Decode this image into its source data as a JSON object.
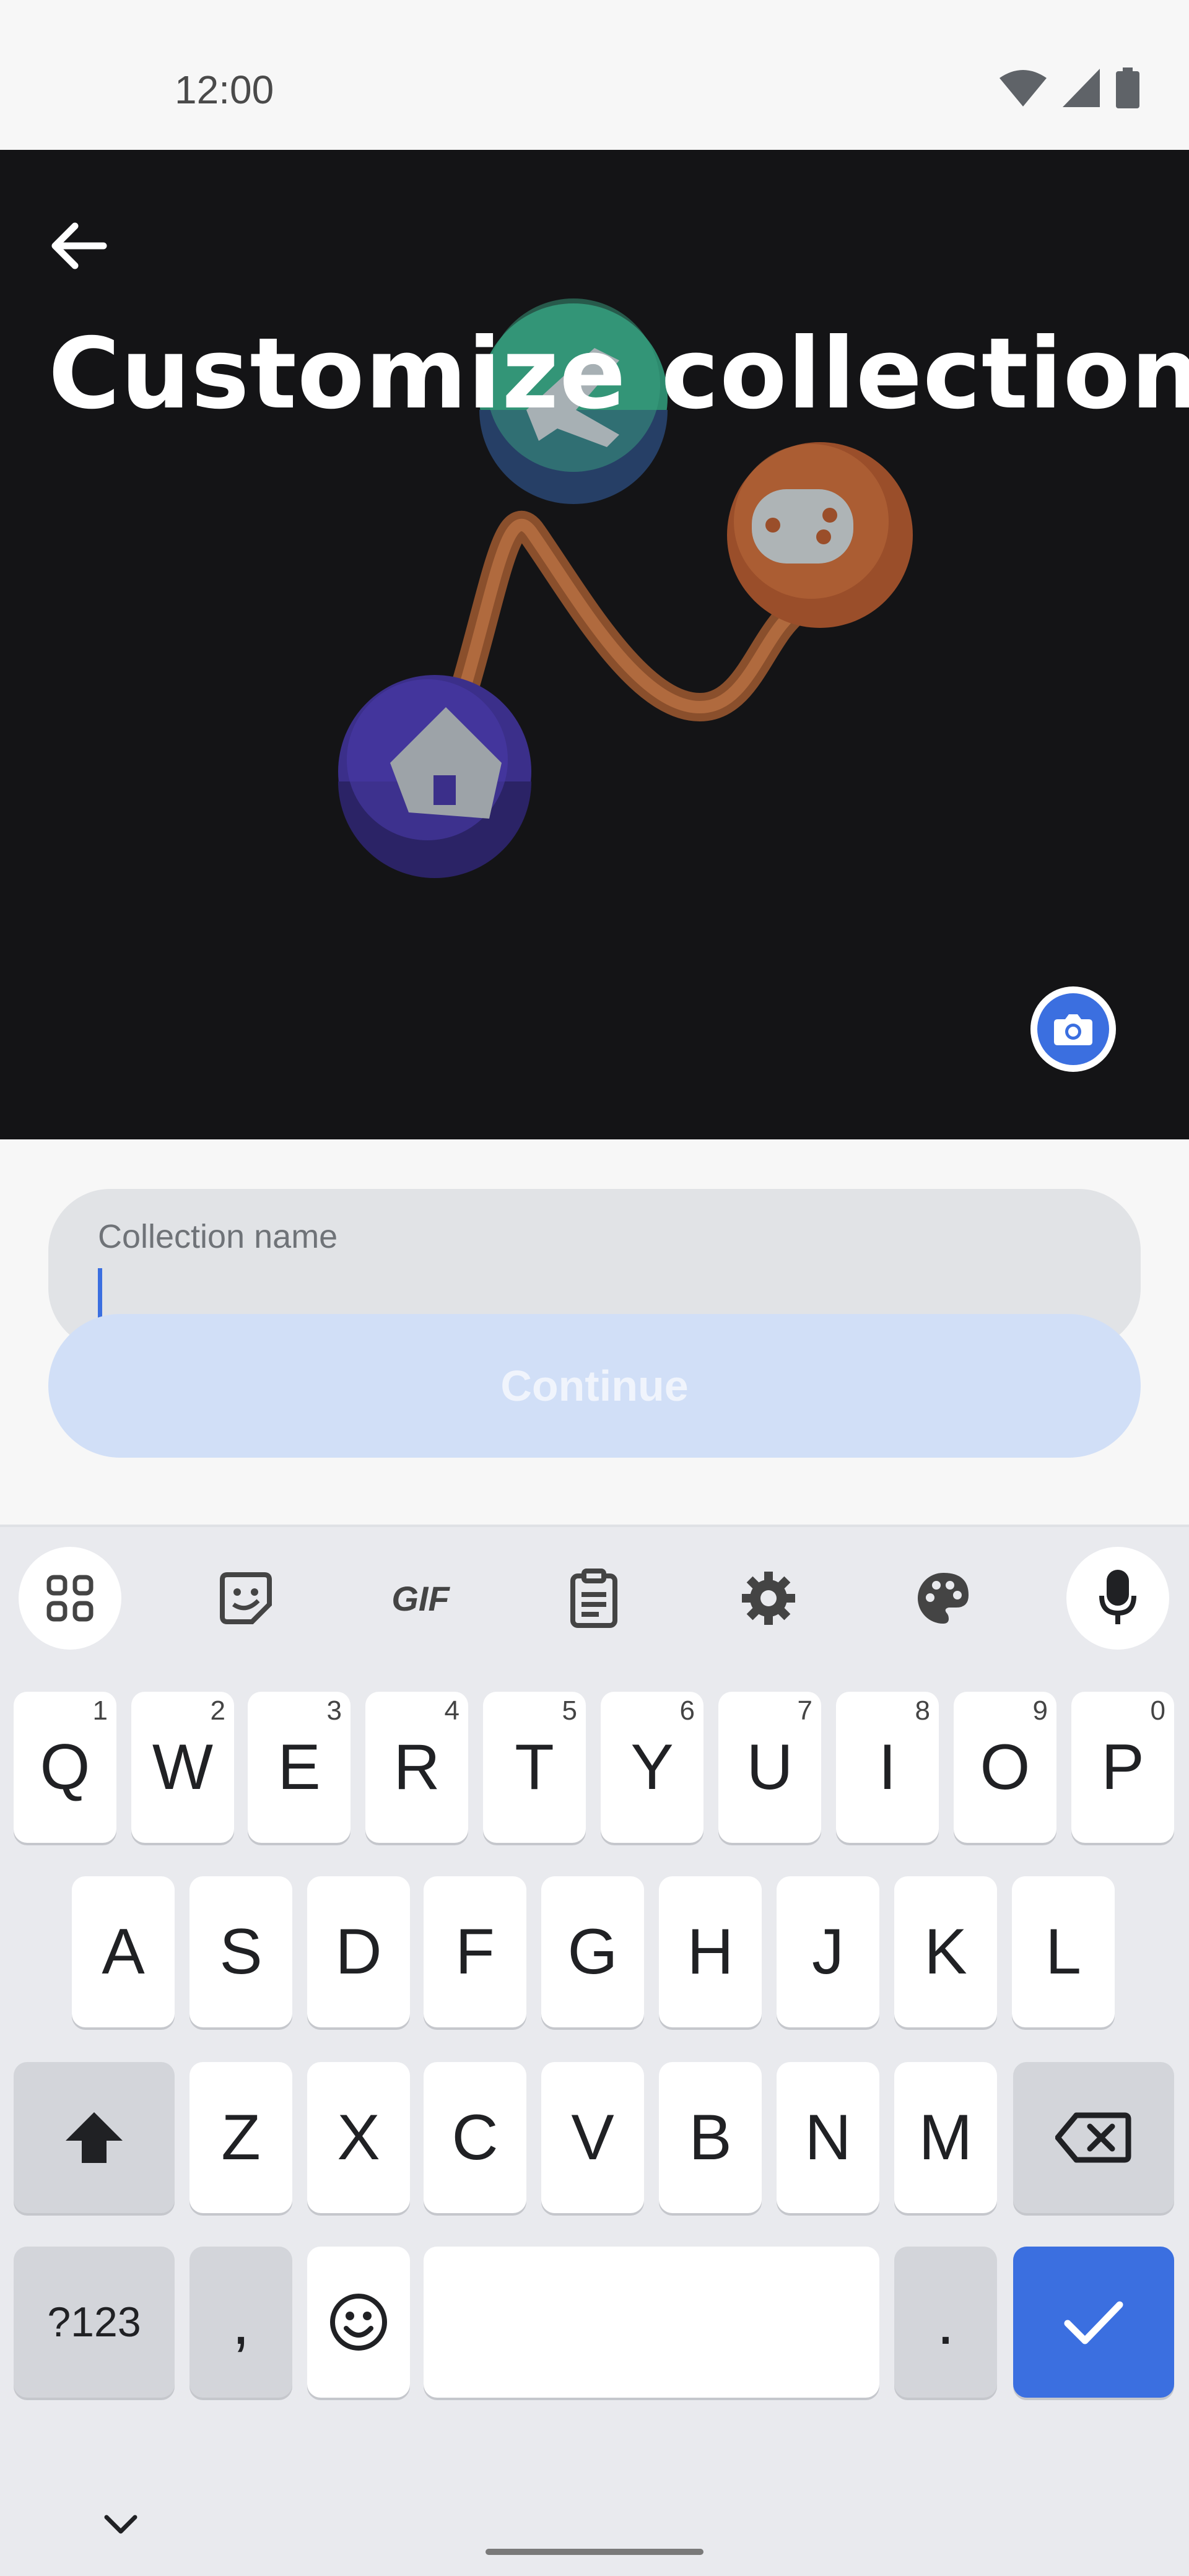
{
  "status_bar": {
    "time": "12:00",
    "icons": [
      "wifi-icon",
      "cell-signal-icon",
      "battery-icon"
    ]
  },
  "header": {
    "title": "Customize collection",
    "back_icon": "arrow-left-icon",
    "camera_icon": "camera-icon"
  },
  "form": {
    "name_label": "Collection name",
    "name_value": "",
    "continue_label": "Continue"
  },
  "keyboard": {
    "toolbar": [
      "apps-grid-icon",
      "sticker-icon",
      "gif-icon",
      "clipboard-icon",
      "settings-gear-icon",
      "palette-icon",
      "microphone-icon"
    ],
    "gif_label": "GIF",
    "row1": [
      {
        "label": "Q",
        "num": "1"
      },
      {
        "label": "W",
        "num": "2"
      },
      {
        "label": "E",
        "num": "3"
      },
      {
        "label": "R",
        "num": "4"
      },
      {
        "label": "T",
        "num": "5"
      },
      {
        "label": "Y",
        "num": "6"
      },
      {
        "label": "U",
        "num": "7"
      },
      {
        "label": "I",
        "num": "8"
      },
      {
        "label": "O",
        "num": "9"
      },
      {
        "label": "P",
        "num": "0"
      }
    ],
    "row2": [
      "A",
      "S",
      "D",
      "F",
      "G",
      "H",
      "J",
      "K",
      "L"
    ],
    "row3": [
      "Z",
      "X",
      "C",
      "V",
      "B",
      "N",
      "M"
    ],
    "symbols_label": "?123",
    "comma_label": ",",
    "period_label": ".",
    "accent": "#3b6fe0"
  }
}
